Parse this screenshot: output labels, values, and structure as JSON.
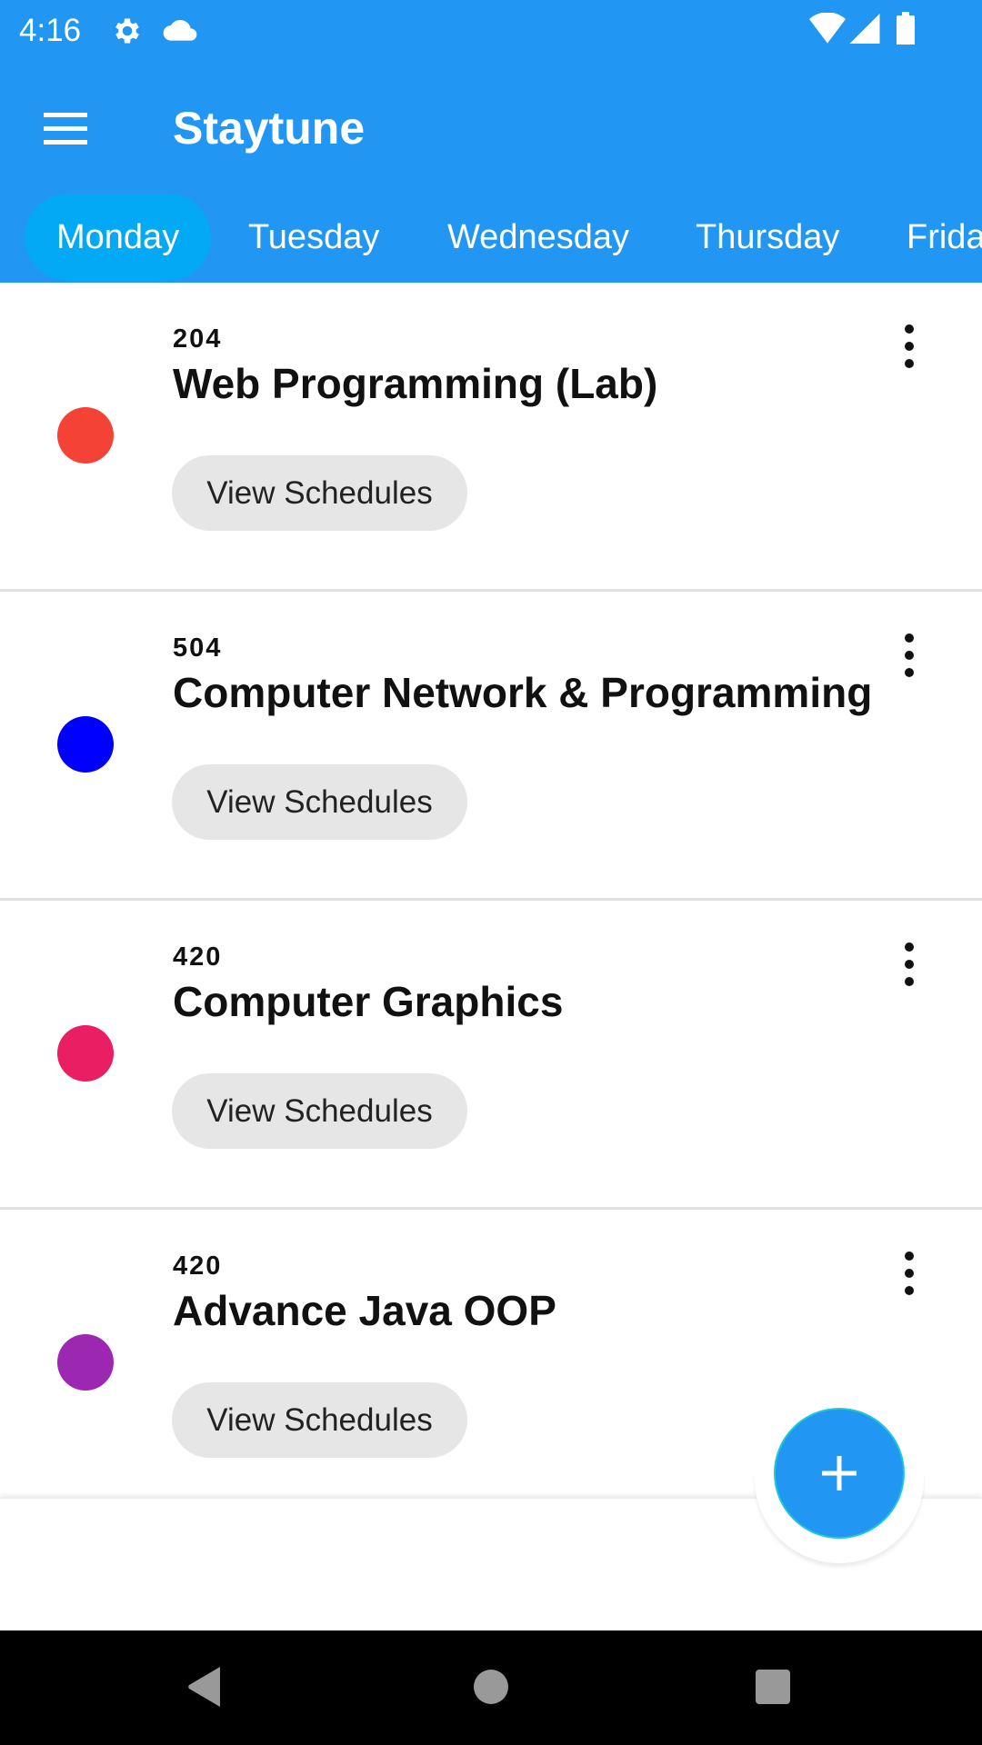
{
  "status_bar": {
    "time": "4:16",
    "icons": [
      "gear-icon",
      "cloud-icon",
      "wifi-icon",
      "signal-icon",
      "battery-icon"
    ]
  },
  "app_bar": {
    "title": "Staytune",
    "menu_icon": "hamburger-menu-icon"
  },
  "tabs": [
    {
      "label": "Monday",
      "active": true
    },
    {
      "label": "Tuesday"
    },
    {
      "label": "Wednesday"
    },
    {
      "label": "Thursday"
    },
    {
      "label": "Frida"
    }
  ],
  "courses": [
    {
      "room": "204",
      "title": "Web Programming (Lab)",
      "color": "#F44336",
      "button": "View Schedules"
    },
    {
      "room": "504",
      "title": "Computer Network & Programming",
      "color": "#0000FF",
      "button": "View Schedules"
    },
    {
      "room": "420",
      "title": "Computer Graphics",
      "color": "#E91E63",
      "button": "View Schedules"
    },
    {
      "room": "420",
      "title": "Advance Java OOP",
      "color": "#9C27B0",
      "button": "View Schedules"
    }
  ],
  "colors": {
    "primary": "#2196F3",
    "tab_active": "#03A9F4"
  },
  "fab": {
    "icon": "plus-icon"
  }
}
